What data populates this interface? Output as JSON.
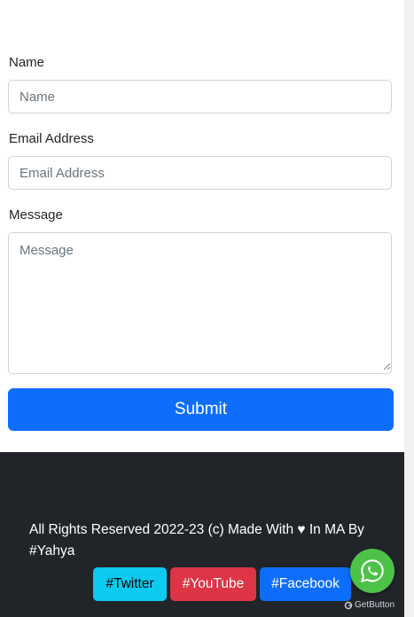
{
  "form": {
    "name_label": "Name",
    "name_placeholder": "Name",
    "email_label": "Email Address",
    "email_placeholder": "Email Address",
    "message_label": "Message",
    "message_placeholder": "Message",
    "submit_label": "Submit"
  },
  "footer": {
    "copyright_text": "All Rights Reserved 2022-23 (c) Made With ♥ In MA By #Yahya",
    "social_links": {
      "twitter": "#Twitter",
      "youtube": "#YouTube",
      "facebook": "#Facebook"
    }
  },
  "widget": {
    "icon": "whatsapp-icon",
    "branding": "GetButton"
  },
  "colors": {
    "primary": "#0d6efd",
    "info": "#0dcaf0",
    "danger": "#dc3545",
    "footer_bg": "#212529",
    "whatsapp": "#4dc247"
  }
}
